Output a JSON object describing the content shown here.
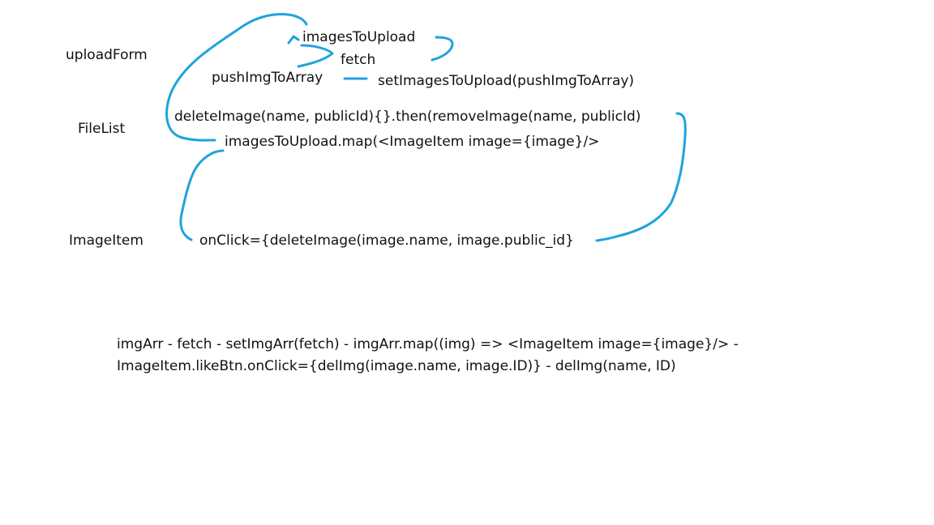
{
  "stroke_color": "#1fa3dc",
  "labels": {
    "upload_form": "uploadForm",
    "file_list": "FileList",
    "image_item": "ImageItem"
  },
  "nodes": {
    "images_to_upload": "imagesToUpload",
    "fetch": "fetch",
    "push_img_to_array": "pushImgToArray",
    "set_images_to_upload": "setImagesToUpload(pushImgToArray)",
    "delete_image": "deleteImage(name, publicId){}.then(removeImage(name, publicId)",
    "images_map": "imagesToUpload.map(<ImageItem image={image}/>",
    "on_click": "onClick={deleteImage(image.name, image.public_id}"
  },
  "notes": {
    "line1": "imgArr - fetch - setImgArr(fetch) - imgArr.map((img) => <ImageItem image={image}/> -",
    "line2": "ImageItem.likeBtn.onClick={delImg(image.name, image.ID)} - delImg(name, ID)"
  }
}
